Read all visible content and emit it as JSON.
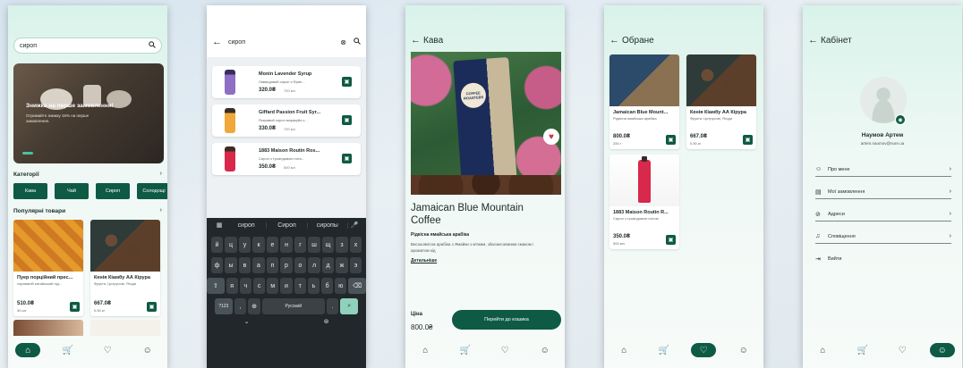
{
  "colors": {
    "accent": "#0e5a44",
    "bg": "#eef8f4"
  },
  "nav": {
    "home": "⌂",
    "cart": "🛒",
    "fav": "♡",
    "profile": "☺"
  },
  "home": {
    "search_value": "сироп",
    "banner_title": "Знижка на перше замовлення!",
    "banner_text": "Отримайте знижку 15% на перше замовлення.",
    "categories_title": "Категорії",
    "categories": [
      "Кава",
      "Чай",
      "Сироп",
      "Солодощі"
    ],
    "popular_title": "Популярні товари",
    "products": [
      {
        "name": "Пуер порційний прес...",
        "desc": "справжній китайський під...",
        "price": "510.0₴",
        "qty": "30 шт"
      },
      {
        "name": "Кенія Кіамбу АА Кірура",
        "desc": "Фрукти, Цитрусові, Ягоди",
        "price": "667.0₴",
        "qty": "0.50 кг"
      }
    ]
  },
  "search": {
    "query": "сироп",
    "results": [
      {
        "name": "Monin Lavender Syrup",
        "desc": "Лавандовий сироп з Фран...",
        "price": "320.0₴",
        "vol": "700 мл"
      },
      {
        "name": "Giffard Passion Fruit Syr...",
        "desc": "Яскравий сироп маракуйя з...",
        "price": "330.0₴",
        "vol": "700 мл"
      },
      {
        "name": "1883 Maison Routin Ros...",
        "desc": "Сироп з трояндовою нота...",
        "price": "350.0₴",
        "vol": "500 мл"
      }
    ],
    "suggestions": [
      "сироп",
      "Сироп",
      "сиропы"
    ],
    "keys_row1": [
      "й",
      "ц",
      "у",
      "к",
      "е",
      "н",
      "г",
      "ш",
      "щ",
      "з",
      "х"
    ],
    "keys_row2": [
      "ф",
      "ы",
      "в",
      "а",
      "п",
      "р",
      "о",
      "л",
      "д",
      "ж",
      "э"
    ],
    "keys_row3": [
      "я",
      "ч",
      "с",
      "м",
      "и",
      "т",
      "ь",
      "б",
      "ю"
    ],
    "key_numbers": "?123",
    "key_comma": ",",
    "key_space": "Русский",
    "key_period": "."
  },
  "detail": {
    "header": "Кава",
    "bag_label": "COFFEE ROASTERS",
    "title": "Jamaican Blue Mountain Coffee",
    "origin": "Рідкісна ямайська арабіка",
    "desc": "Високоякісна арабіка з Ямайки з м'яким, збалансованим смаком і ароматом кід",
    "more": "Детальніше",
    "price_label": "Ціна",
    "price": "800.0₴",
    "cart_button": "Перейти до кошика"
  },
  "favorites": {
    "header": "Обране",
    "items": [
      {
        "name": "Jamaican Blue Mount...",
        "desc": "Рідкісна ямайська арабіка",
        "price": "800.0₴",
        "qty": "250 г"
      },
      {
        "name": "Кенія Кіамбу АА Кірура",
        "desc": "Фрукти, Цитрусові, Ягоди",
        "price": "667.0₴",
        "qty": "0.50 кг"
      },
      {
        "name": "1883 Maison Routin R...",
        "desc": "Сироп з трояндовою нотою",
        "price": "350.0₴",
        "qty": "500 мл"
      }
    ]
  },
  "profile": {
    "header": "Кабінет",
    "name": "Наумов Артем",
    "email": "artem.naumov@nure.ua",
    "menu": [
      "Про мене",
      "Мої замовлення",
      "Адреси",
      "Сповіщення",
      "Вийти"
    ]
  }
}
